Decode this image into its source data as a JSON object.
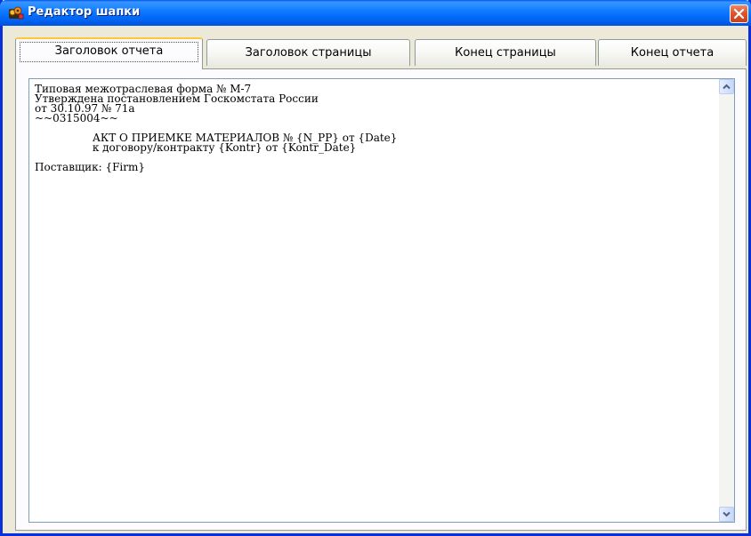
{
  "window": {
    "title": "Редактор шапки"
  },
  "tabs": [
    {
      "label": "Заголовок отчета",
      "active": true
    },
    {
      "label": "Заголовок страницы",
      "active": false
    },
    {
      "label": "Конец страницы",
      "active": false
    },
    {
      "label": "Конец отчета",
      "active": false
    }
  ],
  "editor": {
    "text": "Типовая межотраслевая форма № М-7\nУтверждена постановлением Госкомстата России\nот 30.10.97 № 71а\n~~0315004~~\n\n                 АКТ О ПРИЕМКЕ МАТЕРИАЛОВ № {N_PP} от {Date}\n                 к договору/контракту {Kontr} от {Kontr_Date}\n\nПоставщик: {Firm}"
  },
  "icons": {
    "app": "reel-app-icon",
    "close": "close-icon",
    "scroll_up": "scroll-up-icon",
    "scroll_down": "scroll-down-icon"
  },
  "colors": {
    "titlebar": "#0054e3",
    "close_button": "#e0552e",
    "active_tab_highlight": "#ffc83c",
    "dialog_background": "#ece9d8"
  }
}
